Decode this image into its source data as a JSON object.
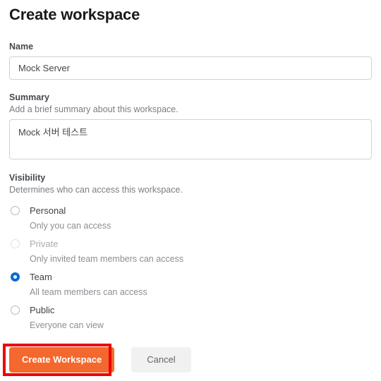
{
  "page": {
    "title": "Create workspace"
  },
  "name_field": {
    "label": "Name",
    "value": "Mock Server",
    "placeholder": ""
  },
  "summary_field": {
    "label": "Summary",
    "help": "Add a brief summary about this workspace.",
    "value": "Mock 서버 테스트",
    "placeholder": ""
  },
  "visibility": {
    "label": "Visibility",
    "help": "Determines who can access this workspace.",
    "options": [
      {
        "label": "Personal",
        "description": "Only you can access",
        "selected": false,
        "disabled": false
      },
      {
        "label": "Private",
        "description": "Only invited team members can access",
        "selected": false,
        "disabled": true
      },
      {
        "label": "Team",
        "description": "All team members can access",
        "selected": true,
        "disabled": false
      },
      {
        "label": "Public",
        "description": "Everyone can view",
        "selected": false,
        "disabled": false
      }
    ]
  },
  "actions": {
    "primary_label": "Create Workspace",
    "secondary_label": "Cancel"
  },
  "colors": {
    "primary_button": "#f4682e",
    "radio_selected": "#0b6bd6",
    "highlight_border": "#ee0000",
    "secondary_button": "#f1f1f2"
  }
}
